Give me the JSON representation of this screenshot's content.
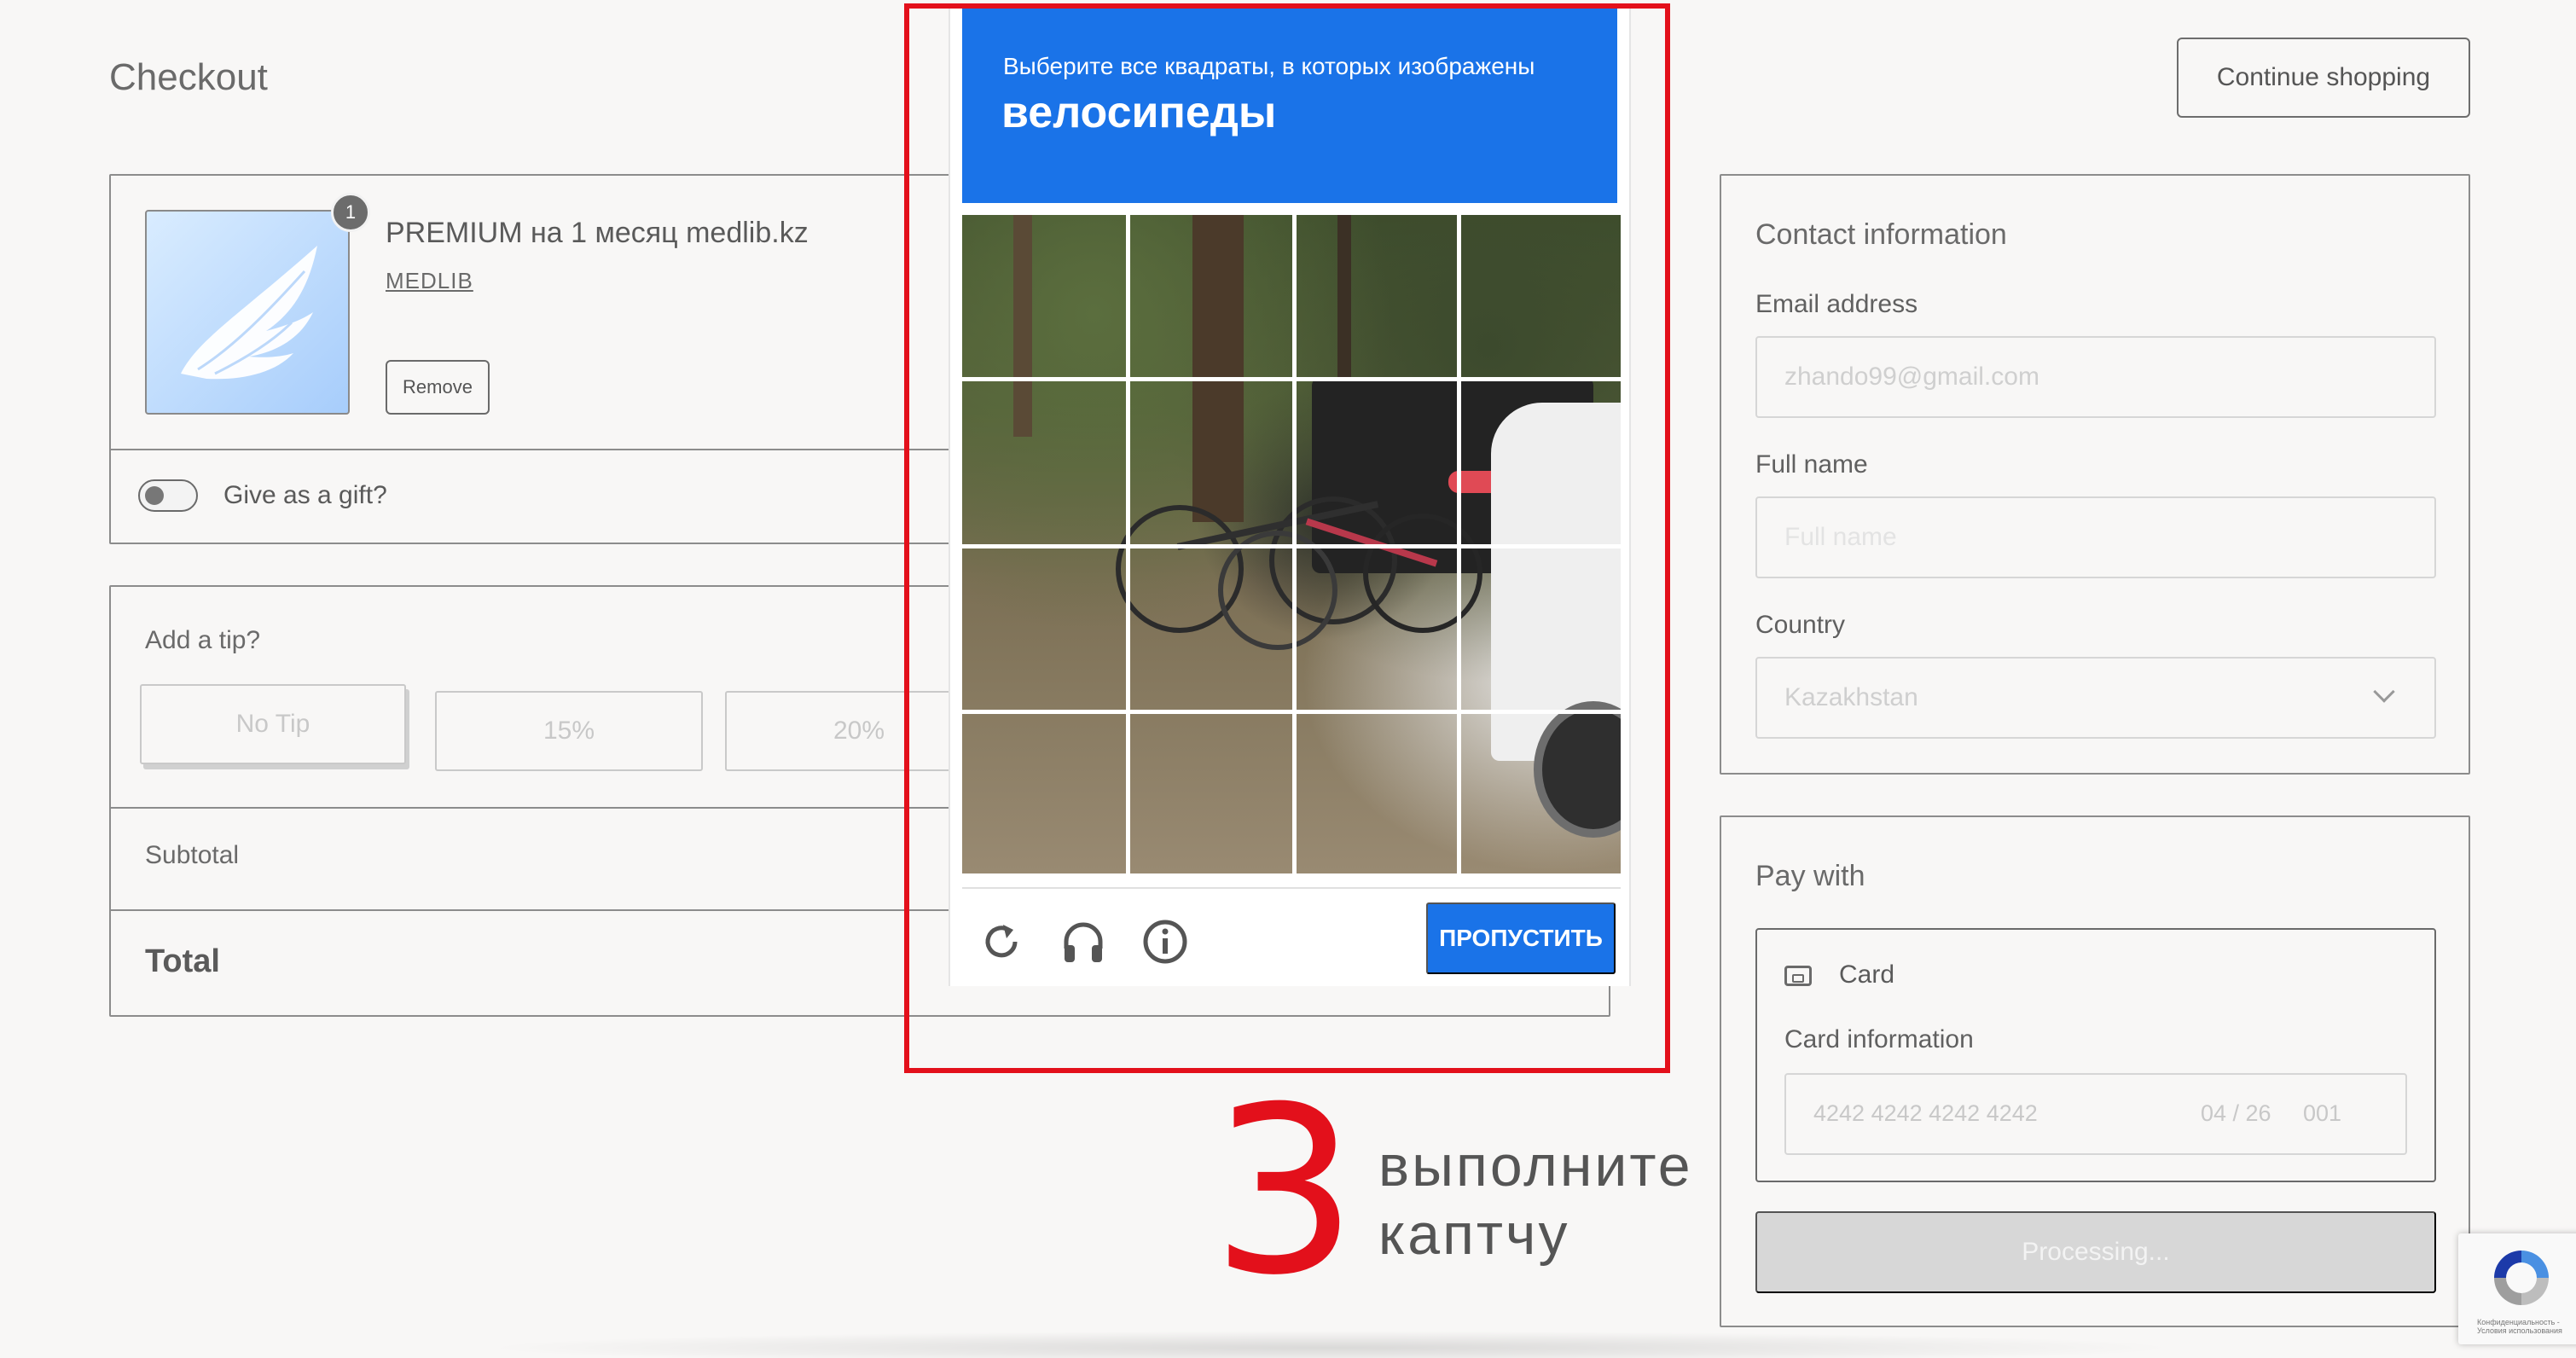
{
  "header": {
    "title": "Checkout",
    "continue_label": "Continue shopping"
  },
  "product": {
    "name": "PREMIUM на 1 месяц medlib.kz",
    "vendor": "MEDLIB",
    "quantity": "1",
    "remove_label": "Remove",
    "gift_label": "Give as a gift?",
    "gift_enabled": false
  },
  "tip": {
    "title": "Add a tip?",
    "options": [
      "No Tip",
      "15%",
      "20%"
    ],
    "subtotal_label": "Subtotal",
    "total_label": "Total"
  },
  "contact": {
    "title": "Contact information",
    "email_label": "Email address",
    "email_placeholder": "zhando99@gmail.com",
    "fullname_label": "Full name",
    "fullname_placeholder": "Full name",
    "country_label": "Country",
    "country_value": "Kazakhstan"
  },
  "payment": {
    "title": "Pay with",
    "method_label": "Card",
    "card_info_label": "Card information",
    "card_number_placeholder": "4242 4242 4242 4242",
    "card_expiry_placeholder": "04 / 26",
    "card_cvc_placeholder": "001",
    "submit_label": "Processing..."
  },
  "captcha": {
    "instruction": "Выберите все квадраты, в которых изображены",
    "target": "велосипеды",
    "skip_label": "ПРОПУСТИТЬ",
    "grid_rows": 4,
    "grid_cols": 4,
    "header_color": "#1a73e8",
    "outline_color": "#e3101b"
  },
  "annotation": {
    "step_number": "3",
    "line1": "выполните",
    "line2": "каптчу"
  },
  "recaptcha_badge": {
    "text": "Конфиденциальность - Условия использования"
  }
}
